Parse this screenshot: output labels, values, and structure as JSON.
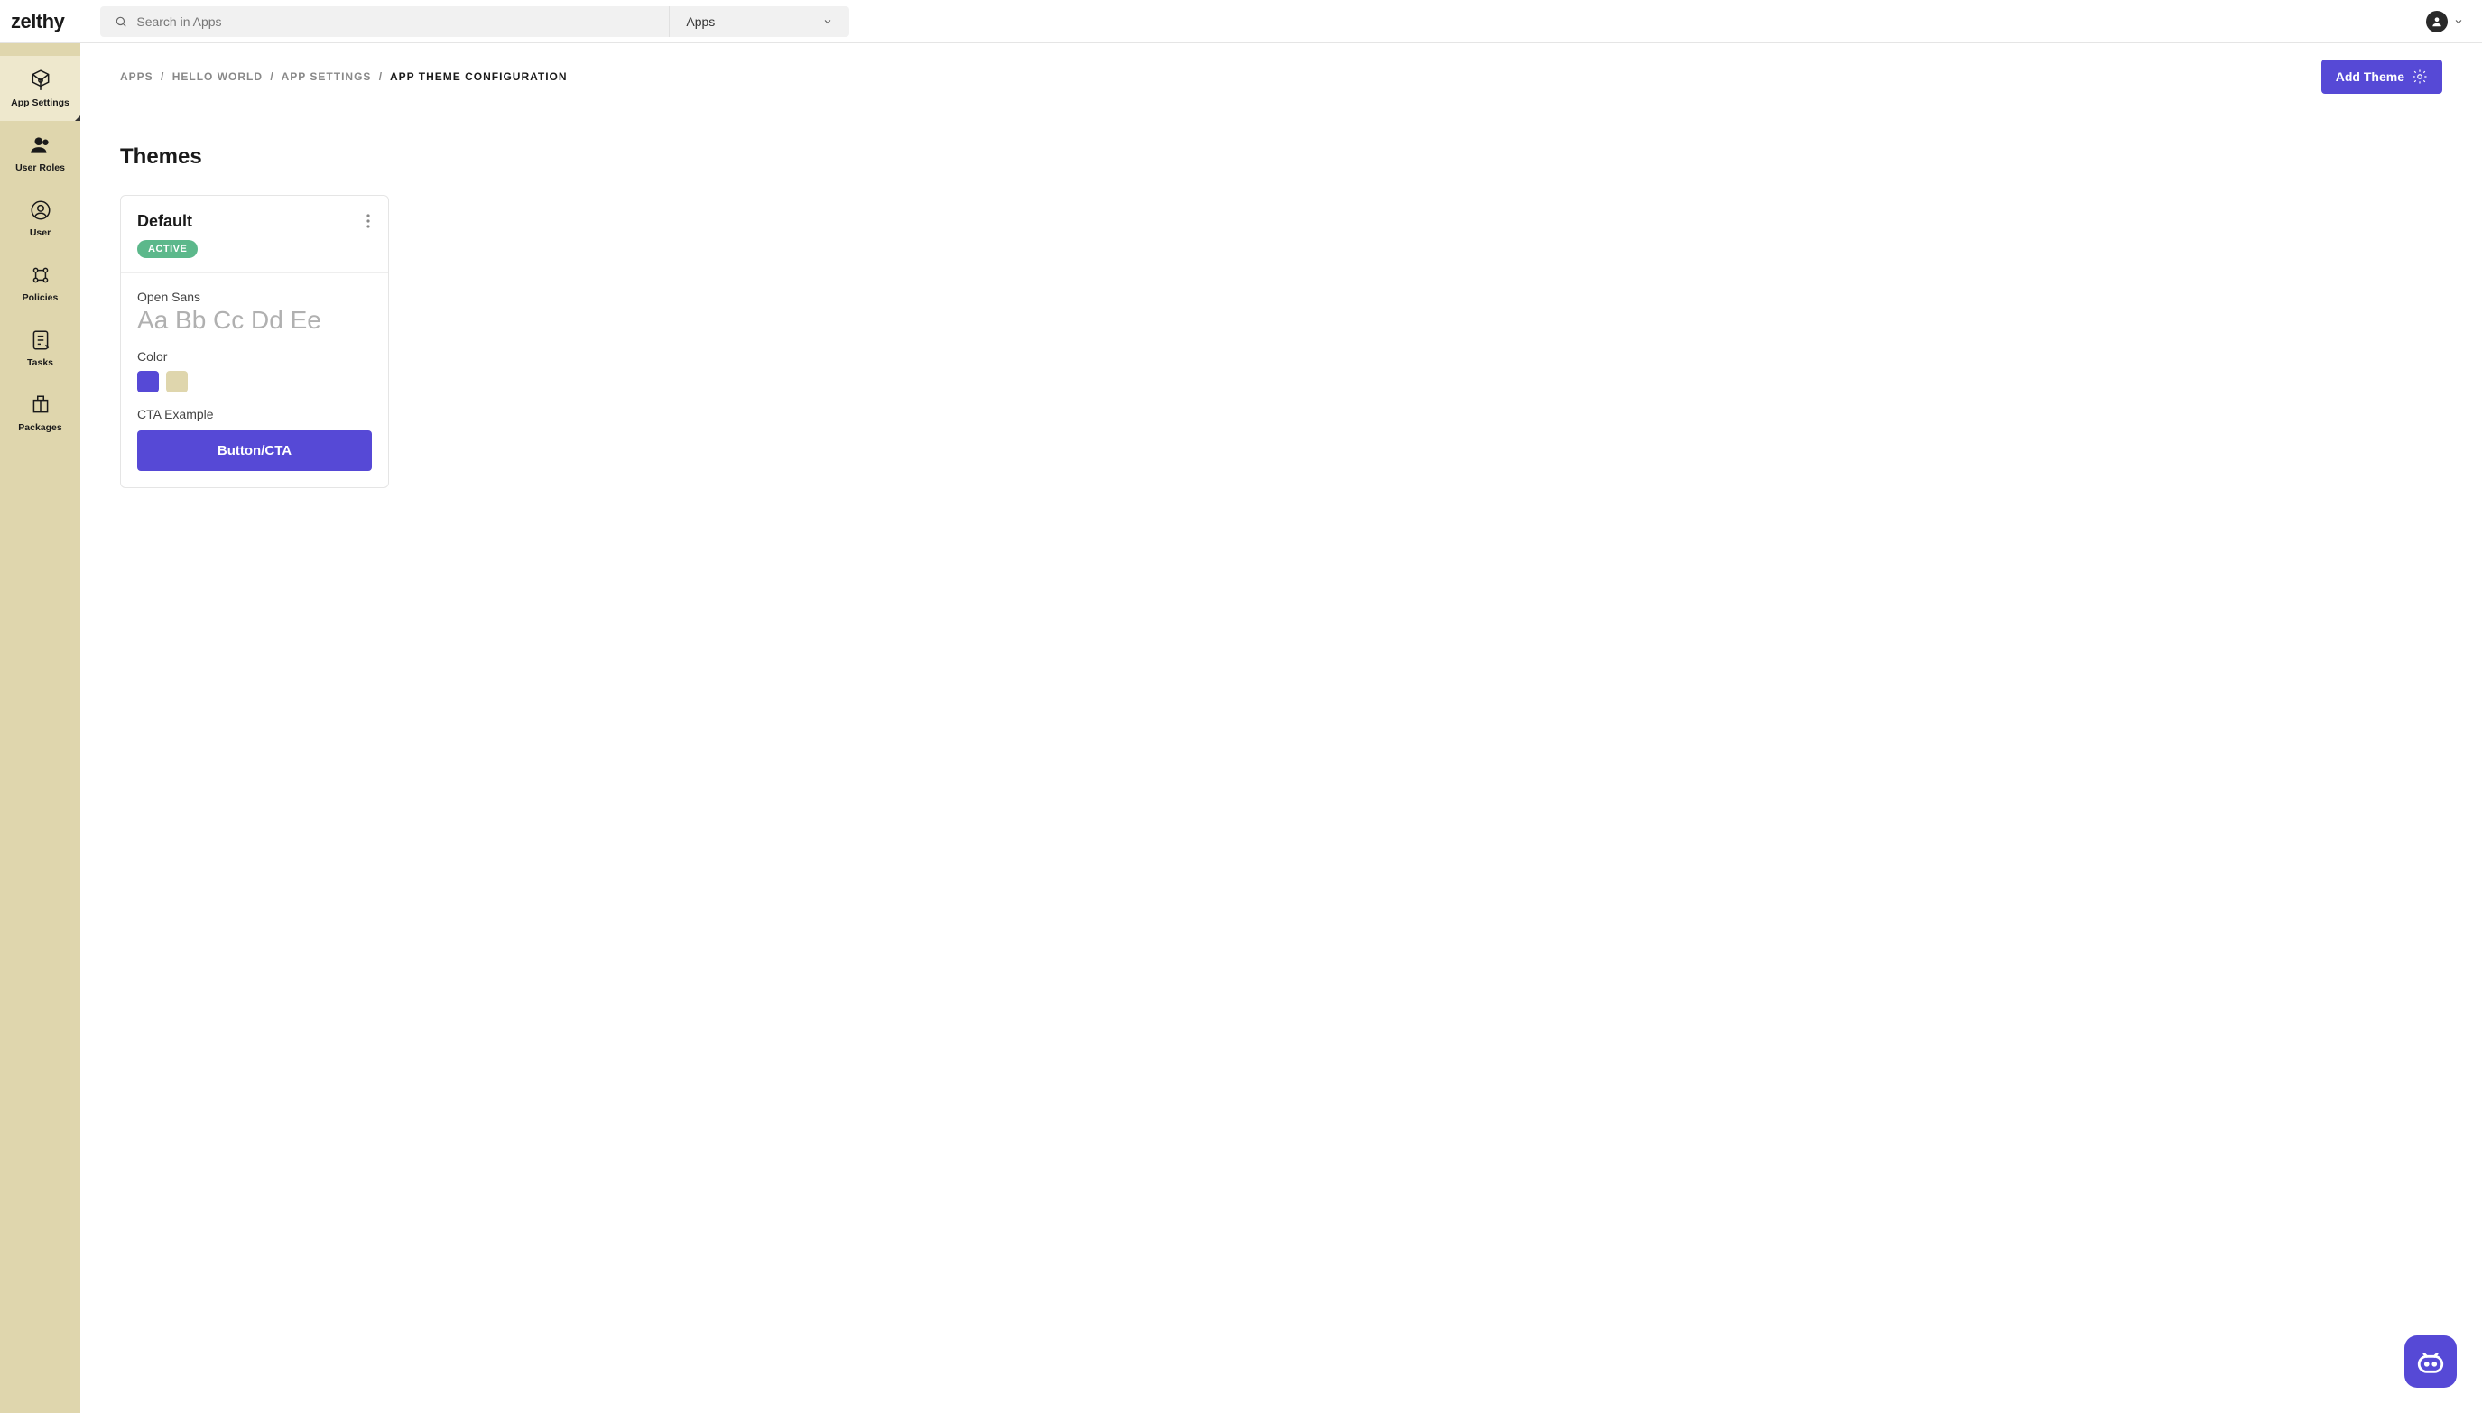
{
  "brand": "zelthy",
  "header": {
    "search_placeholder": "Search in Apps",
    "filter_label": "Apps"
  },
  "sidebar": {
    "items": [
      {
        "label": "App Settings"
      },
      {
        "label": "User Roles"
      },
      {
        "label": "User"
      },
      {
        "label": "Policies"
      },
      {
        "label": "Tasks"
      },
      {
        "label": "Packages"
      }
    ]
  },
  "breadcrumb": {
    "parts": [
      "APPS",
      "HELLO WORLD",
      "APP SETTINGS"
    ],
    "current": "APP THEME CONFIGURATION",
    "sep": "/"
  },
  "actions": {
    "add_theme": "Add Theme"
  },
  "page": {
    "title": "Themes"
  },
  "theme_card": {
    "name": "Default",
    "status": "ACTIVE",
    "font_name": "Open Sans",
    "glyph_sample": "Aa Bb Cc Dd Ee",
    "color_label": "Color",
    "colors": [
      "#5649d6",
      "#dfd6ad"
    ],
    "cta_label": "CTA Example",
    "cta_button": "Button/CTA"
  }
}
